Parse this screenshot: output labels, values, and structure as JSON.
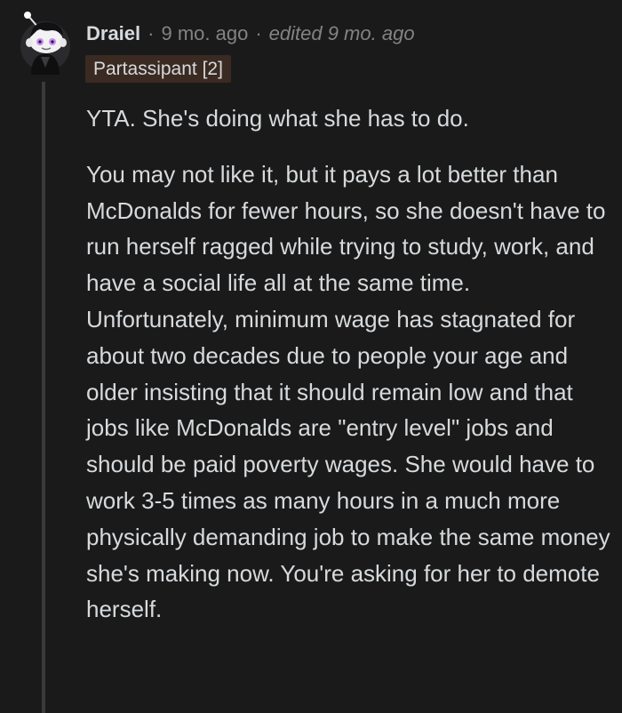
{
  "comment": {
    "author": "Draiel",
    "separator": "·",
    "timestamp": "9 mo. ago",
    "edited": "edited 9 mo. ago",
    "flair": "Partassipant [2]",
    "paragraphs": [
      "YTA. She's doing what she has to do.",
      "You may not like it, but it pays a lot better than McDonalds for fewer hours, so she doesn't have to run herself ragged while trying to study, work, and have a social life all at the same time. Unfortunately, minimum wage has stagnated for about two decades due to people your age and older insisting that it should remain low and that jobs like McDonalds are \"entry level\" jobs and should be paid poverty wages. She would have to work 3-5 times as many hours in a much more physically demanding job to make the same money she's making now. You're asking for her to demote herself."
    ]
  },
  "icons": {
    "avatar": "snoo-avatar-icon"
  },
  "colors": {
    "background": "#1a1a1b",
    "text": "#d7dadc",
    "muted": "#818384",
    "flair_bg": "#3a2a22",
    "thread_line": "#3a3a3c",
    "avatar_accent": "#c88cf0"
  }
}
